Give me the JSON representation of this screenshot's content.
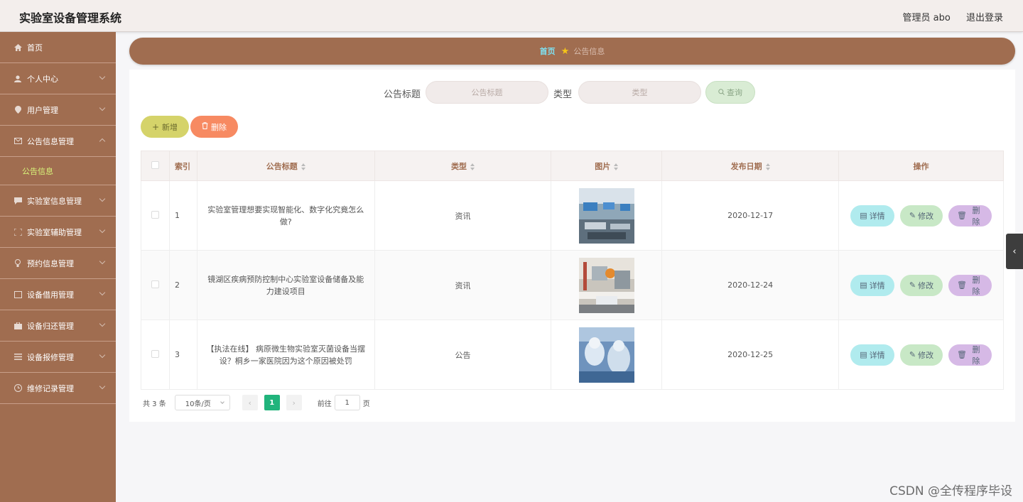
{
  "header": {
    "app_title": "实验室设备管理系统",
    "user_label": "管理员 abo",
    "logout_label": "退出登录"
  },
  "sidebar": {
    "items": [
      {
        "label": "首页",
        "icon": "home-icon"
      },
      {
        "label": "个人中心",
        "icon": "user-icon"
      },
      {
        "label": "用户管理",
        "icon": "location-icon"
      },
      {
        "label": "公告信息管理",
        "icon": "mail-icon"
      },
      {
        "label": "实验室信息管理",
        "icon": "chat-icon"
      },
      {
        "label": "实验室辅助管理",
        "icon": "frame-icon"
      },
      {
        "label": "预约信息管理",
        "icon": "bulb-icon"
      },
      {
        "label": "设备借用管理",
        "icon": "box-icon"
      },
      {
        "label": "设备归还管理",
        "icon": "briefcase-icon"
      },
      {
        "label": "设备报修管理",
        "icon": "list-icon"
      },
      {
        "label": "维修记录管理",
        "icon": "clock-icon"
      }
    ],
    "active_sub": "公告信息"
  },
  "breadcrumb": {
    "home": "首页",
    "current": "公告信息"
  },
  "search": {
    "title_label": "公告标题",
    "title_placeholder": "公告标题",
    "type_label": "类型",
    "type_placeholder": "类型",
    "query_button": "查询"
  },
  "actions": {
    "add": "新增",
    "delete": "删除"
  },
  "table": {
    "columns": [
      "索引",
      "公告标题",
      "类型",
      "图片",
      "发布日期",
      "操作"
    ],
    "rows": [
      {
        "index": "1",
        "title": "实验室管理想要实现智能化、数字化究竟怎么做?",
        "type": "资讯",
        "date": "2020-12-17"
      },
      {
        "index": "2",
        "title": "镜湖区疾病预防控制中心实验室设备储备及能力建设项目",
        "type": "资讯",
        "date": "2020-12-24"
      },
      {
        "index": "3",
        "title": "【执法在线】 病原微生物实验室灭菌设备当摆设？桐乡一家医院因为这个原因被处罚",
        "type": "公告",
        "date": "2020-12-25"
      }
    ],
    "op_detail": "详情",
    "op_edit": "修改",
    "op_delete": "删除"
  },
  "pagination": {
    "total": "共 3 条",
    "page_size": "10条/页",
    "current_page": "1",
    "goto_prefix": "前往",
    "goto_value": "1",
    "goto_suffix": "页"
  },
  "watermark": "CSDN @全传程序毕设",
  "colors": {
    "sidebar": "#a06d50",
    "accent_green": "#21b47c",
    "active_sub": "#d8f57a"
  }
}
